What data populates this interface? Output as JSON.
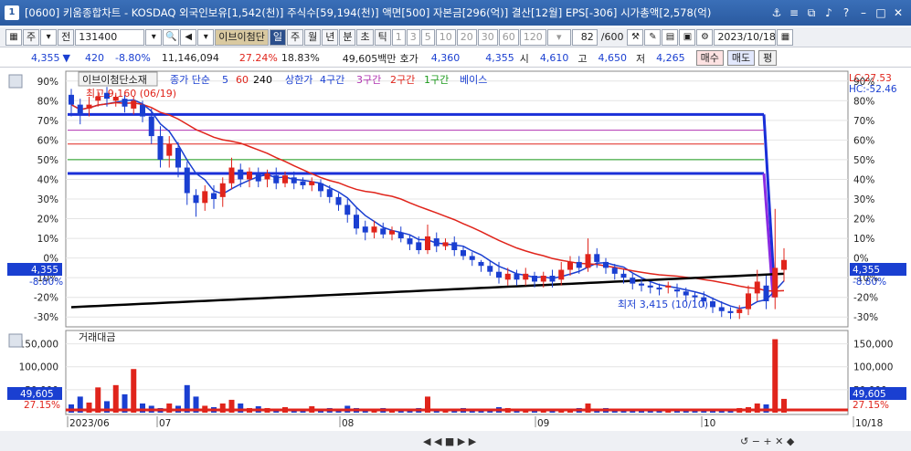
{
  "window": {
    "number": "1",
    "title": "[0600] 키움종합차트 - KOSDAQ 외국인보유[1,542(천)] 주식수[59,194(천)] 액면[500] 자본금[296(억)] 결산[12월] EPS[-306] 시가총액[2,578(억)"
  },
  "toolbar": {
    "period_type": "주",
    "code_mode": "전",
    "stock_code": "131400",
    "stock_name": "이브이첨단",
    "intervals": [
      "일",
      "주",
      "월",
      "년",
      "분",
      "초",
      "틱"
    ],
    "minute_steps": [
      "1",
      "3",
      "5",
      "10",
      "20",
      "30",
      "60",
      "120"
    ],
    "count": "82",
    "count_total": "/600",
    "date": "2023/10/18"
  },
  "pricebar": {
    "price": "4,355",
    "change": "420",
    "change_rate": "-8.80%",
    "volume": "11,146,094",
    "turnover_rate": "27.24%",
    "ratio2": "18.83%",
    "amount": "49,605백만",
    "quote_label": "호가",
    "quote": "4,360",
    "current": "4,355",
    "open_label": "시",
    "open": "4,610",
    "high_label": "고",
    "high": "4,650",
    "low_label": "저",
    "low": "4,265",
    "buy_label": "매수",
    "sell_label": "매도",
    "p_label": "평"
  },
  "legend": {
    "name": "이브이첨단소재",
    "ma_label": "종가 단순",
    "ma5": "5",
    "ma60": "60",
    "ma240": "240",
    "ceiling": "상한가",
    "c4": "4구간",
    "c3": "3구간",
    "c2": "2구간",
    "c1": "1구간",
    "base": "베이스"
  },
  "annotations": {
    "high": "최고 9,160 (06/19)",
    "low": "최저 3,415 (10/10)",
    "lc": "LC:27.53",
    "hc": "HC:-52.46"
  },
  "price_panel": {
    "left_ticks": [
      "90%",
      "80%",
      "70%",
      "60%",
      "50%",
      "40%",
      "30%",
      "20%",
      "10%",
      "0%",
      "-10%",
      "-20%",
      "-30%"
    ],
    "right_ticks": [
      "90%",
      "80%",
      "70%",
      "60%",
      "50%",
      "40%",
      "30%",
      "20%",
      "10%",
      "0%",
      "-10%",
      "-20%",
      "-30%"
    ],
    "current_label": "4,355",
    "current_pct": "-8.80%"
  },
  "volume_panel": {
    "title": "거래대금",
    "left_ticks": [
      "150,000",
      "100,000",
      "50,000"
    ],
    "right_ticks": [
      "150,000",
      "100,000",
      "50,000"
    ],
    "current_label": "49,605",
    "current_pct": "27.15%"
  },
  "xaxis": {
    "labels": [
      "2023/06",
      "07",
      "08",
      "09",
      "10",
      "10/18"
    ]
  },
  "chart_data": {
    "type": "candlestick",
    "y_axis": "percent",
    "ylim": [
      -35,
      95
    ],
    "candles": [
      [
        -2,
        3,
        -6,
        83,
        78
      ],
      [
        -1,
        3,
        -5,
        78,
        73
      ],
      [
        0,
        4,
        -4,
        76,
        78
      ],
      [
        0,
        3,
        -3,
        80,
        82
      ],
      [
        -1,
        3,
        -4,
        84,
        81
      ],
      [
        0,
        2,
        -3,
        80,
        82
      ],
      [
        0,
        2,
        -3,
        81,
        77
      ],
      [
        0,
        2,
        -3,
        76,
        80
      ],
      [
        -1,
        2,
        -3,
        78,
        72
      ],
      [
        -2,
        4,
        -4,
        72,
        62
      ],
      [
        -3,
        5,
        -4,
        62,
        50
      ],
      [
        -4,
        4,
        -6,
        52,
        58
      ],
      [
        -2,
        3,
        -5,
        56,
        46
      ],
      [
        -3,
        3,
        -6,
        46,
        33
      ],
      [
        -2,
        3,
        -7,
        32,
        28
      ],
      [
        -2,
        3,
        -4,
        28,
        34
      ],
      [
        0,
        4,
        -5,
        33,
        30
      ],
      [
        -1,
        3,
        -5,
        31,
        38
      ],
      [
        -1,
        5,
        -3,
        38,
        46
      ],
      [
        -1,
        3,
        -4,
        45,
        40
      ],
      [
        -2,
        2,
        -4,
        40,
        44
      ],
      [
        -1,
        3,
        -3,
        43,
        39
      ],
      [
        -1,
        2,
        -4,
        40,
        43
      ],
      [
        -1,
        4,
        -3,
        42,
        38
      ],
      [
        -2,
        2,
        -2,
        38,
        42
      ],
      [
        -1,
        3,
        -3,
        41,
        38
      ],
      [
        -1,
        2,
        -2,
        39,
        37
      ],
      [
        -1,
        2,
        -3,
        37,
        39
      ],
      [
        -1,
        2,
        -3,
        38,
        34
      ],
      [
        -2,
        2,
        -3,
        35,
        31
      ],
      [
        -2,
        2,
        -3,
        31,
        27
      ],
      [
        -3,
        3,
        -4,
        27,
        22
      ],
      [
        -4,
        4,
        -3,
        22,
        15
      ],
      [
        -4,
        3,
        -4,
        16,
        13
      ],
      [
        -3,
        3,
        -3,
        13,
        16
      ],
      [
        -3,
        3,
        -2,
        15,
        12
      ],
      [
        -3,
        2,
        -3,
        12,
        14
      ],
      [
        -3,
        3,
        -2,
        13,
        10
      ],
      [
        -3,
        2,
        -3,
        10,
        7
      ],
      [
        -3,
        3,
        -2,
        8,
        4
      ],
      [
        -3,
        6,
        -2,
        4,
        11
      ],
      [
        -3,
        3,
        -3,
        10,
        6
      ],
      [
        -3,
        2,
        -2,
        6,
        8
      ],
      [
        -3,
        3,
        -3,
        8,
        4
      ],
      [
        -3,
        2,
        -2,
        4,
        1
      ],
      [
        -3,
        2,
        -3,
        1,
        -1
      ],
      [
        -3,
        1,
        -3,
        -2,
        -4
      ],
      [
        -4,
        3,
        -2,
        -4,
        -7
      ],
      [
        -4,
        5,
        -3,
        -7,
        -10
      ],
      [
        -4,
        3,
        -3,
        -11,
        -8
      ],
      [
        -4,
        2,
        -3,
        -8,
        -11
      ],
      [
        -4,
        3,
        -3,
        -11,
        -8
      ],
      [
        -4,
        2,
        -3,
        -9,
        -12
      ],
      [
        -4,
        2,
        -3,
        -12,
        -9
      ],
      [
        -4,
        3,
        -3,
        -9,
        -12
      ],
      [
        -4,
        4,
        -3,
        -11,
        -6
      ],
      [
        -4,
        3,
        -3,
        -6,
        -2
      ],
      [
        -3,
        3,
        -3,
        -2,
        -5
      ],
      [
        -3,
        8,
        -2,
        -5,
        2
      ],
      [
        -3,
        3,
        -3,
        2,
        -2
      ],
      [
        -3,
        2,
        -3,
        -2,
        -5
      ],
      [
        -3,
        2,
        -3,
        -5,
        -8
      ],
      [
        -4,
        2,
        -3,
        -8,
        -10
      ],
      [
        -4,
        2,
        -3,
        -10,
        -13
      ],
      [
        -4,
        3,
        -3,
        -13,
        -14
      ],
      [
        -4,
        2,
        -3,
        -14,
        -15
      ],
      [
        -4,
        2,
        -3,
        -15,
        -16
      ],
      [
        -4,
        2,
        -3,
        -15,
        -14
      ],
      [
        -4,
        3,
        -3,
        -16,
        -17
      ],
      [
        -4,
        2,
        -3,
        -17,
        -19
      ],
      [
        -4,
        2,
        -3,
        -19,
        -20
      ],
      [
        -4,
        3,
        -3,
        -20,
        -22
      ],
      [
        -4,
        2,
        -3,
        -22,
        -25
      ],
      [
        -4,
        3,
        -3,
        -25,
        -27
      ],
      [
        -4,
        2,
        -3,
        -27,
        -28
      ],
      [
        -4,
        2,
        -3,
        -28,
        -26
      ],
      [
        -4,
        4,
        -3,
        -26,
        -18
      ],
      [
        -5,
        6,
        -4,
        -18,
        -12
      ],
      [
        -5,
        5,
        -4,
        -14,
        -22
      ],
      [
        -6,
        30,
        -6,
        -20,
        -5
      ],
      [
        -6,
        6,
        -6,
        -6,
        -1
      ]
    ],
    "volume": [
      18,
      35,
      22,
      55,
      25,
      60,
      40,
      95,
      20,
      15,
      10,
      20,
      15,
      60,
      35,
      15,
      12,
      20,
      28,
      20,
      10,
      14,
      10,
      8,
      12,
      8,
      6,
      14,
      8,
      10,
      6,
      15,
      10,
      8,
      6,
      10,
      6,
      5,
      8,
      10,
      35,
      6,
      5,
      6,
      10,
      5,
      6,
      8,
      12,
      10,
      6,
      5,
      8,
      6,
      5,
      6,
      8,
      10,
      20,
      8,
      10,
      6,
      5,
      6,
      8,
      5,
      4,
      6,
      5,
      6,
      6,
      5,
      4,
      5,
      8,
      10,
      12,
      20,
      18,
      160,
      30
    ]
  }
}
